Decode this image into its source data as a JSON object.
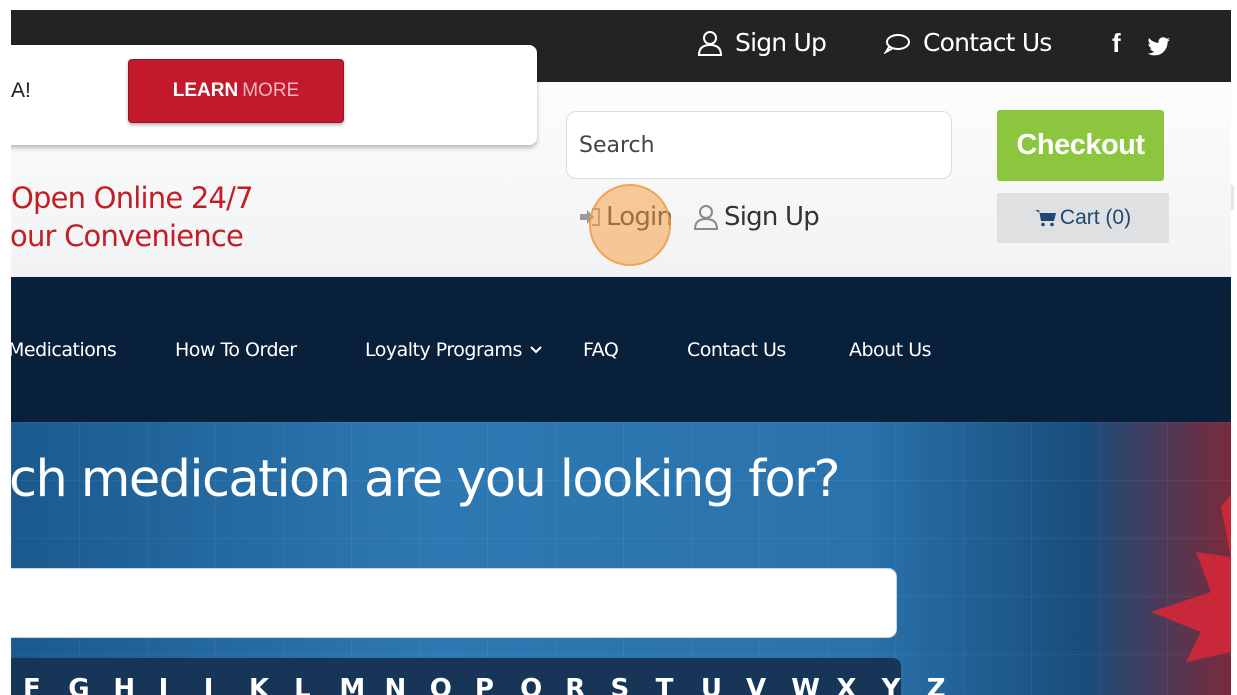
{
  "topbar": {
    "signup_label": "Sign Up",
    "contact_label": "Contact Us",
    "facebook_glyph": "f",
    "icons": [
      "user-icon",
      "chat-bubble-icon",
      "facebook-icon",
      "twitter-icon"
    ]
  },
  "promo": {
    "text": "A!",
    "learn_bold": "LEARN",
    "learn_light": "MORE"
  },
  "tagline": {
    "line1": "Open Online 24/7",
    "line2": "our Convenience"
  },
  "search": {
    "placeholder": "Search"
  },
  "checkout_label": "Checkout",
  "login_label": "Login",
  "signup_label": "Sign Up",
  "cart_label": "Cart (0)",
  "nav": {
    "items": [
      "Medications",
      "How To Order",
      "Loyalty Programs",
      "FAQ",
      "Contact Us",
      "About Us"
    ]
  },
  "hero": {
    "title": "ch medication are you looking for?",
    "letters": [
      "F",
      "G",
      "H",
      "I",
      "J",
      "K",
      "L",
      "M",
      "N",
      "O",
      "P",
      "Q",
      "R",
      "S",
      "T",
      "U",
      "V",
      "W",
      "X",
      "Y",
      "Z"
    ]
  },
  "colors": {
    "topbar": "#232323",
    "nav": "#09203a",
    "learn_button": "#c3192d",
    "checkout_button": "#8cc63f",
    "tagline": "#c21f24",
    "cart_text": "#1c4a73"
  }
}
